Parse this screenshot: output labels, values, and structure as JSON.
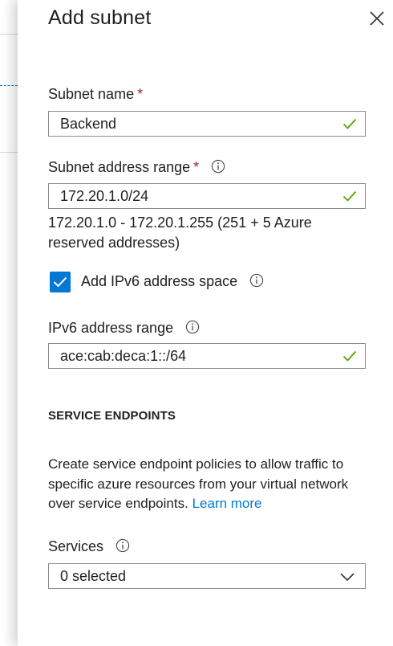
{
  "panel": {
    "title": "Add subnet"
  },
  "subnet_name": {
    "label": "Subnet name",
    "required_marker": "*",
    "value": "Backend"
  },
  "subnet_range": {
    "label": "Subnet address range",
    "required_marker": "*",
    "value": "172.20.1.0/24",
    "note": "172.20.1.0 - 172.20.1.255 (251 + 5 Azure reserved addresses)"
  },
  "ipv6_toggle": {
    "label": "Add IPv6 address space",
    "checked": true
  },
  "ipv6_range": {
    "label": "IPv6 address range",
    "value": "ace:cab:deca:1::/64"
  },
  "service_endpoints": {
    "heading": "SERVICE ENDPOINTS",
    "description": "Create service endpoint policies to allow traffic to specific azure resources from your virtual network over service endpoints.",
    "link": "Learn more"
  },
  "services": {
    "label": "Services",
    "selected": "0 selected"
  },
  "colors": {
    "accent": "#0078d4",
    "valid_check": "#57a300",
    "required": "#a4262c"
  },
  "icons": {
    "close": "close-icon",
    "info": "info-icon",
    "check": "checkmark-icon",
    "dropdown": "chevron-down-icon"
  }
}
